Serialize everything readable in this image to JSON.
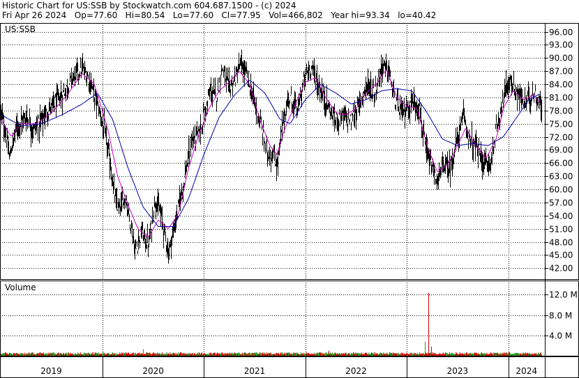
{
  "header": {
    "line1": "Historic Chart for US:SSB by Stockwatch.com 604.687.1500 - (c) 2024",
    "line2": "Fri Apr 26 2024   Op=77.60   Hi=80.54   Lo=77.60   Cl=77.95   Vol=466,802   Year hi=93.34   lo=40.42"
  },
  "colors": {
    "price_bars": "#000000",
    "ma_short": "#cc00cc",
    "ma_long": "#0000aa",
    "volume_up": "#2a9a2a",
    "volume_down": "#dd0000",
    "grid": "#000000"
  },
  "chart_data": [
    {
      "type": "line",
      "title": "US:SSB",
      "series_style": "ohlc bars with two moving averages",
      "y_ticks": [
        "96.00",
        "93.00",
        "90.00",
        "87.00",
        "84.00",
        "81.00",
        "78.00",
        "75.00",
        "72.00",
        "69.00",
        "66.00",
        "63.00",
        "60.00",
        "57.00",
        "54.00",
        "51.00",
        "48.00",
        "45.00",
        "42.00"
      ],
      "ylim": [
        39.5,
        98.0
      ],
      "x_labels": [
        "2019",
        "2020",
        "2021",
        "2022",
        "2023",
        "2024"
      ],
      "price_points": [
        {
          "t": 2019.0,
          "v": 77.5
        },
        {
          "t": 2019.05,
          "v": 72.0
        },
        {
          "t": 2019.08,
          "v": 67.0
        },
        {
          "t": 2019.15,
          "v": 74.5
        },
        {
          "t": 2019.25,
          "v": 76.5
        },
        {
          "t": 2019.32,
          "v": 73.5
        },
        {
          "t": 2019.4,
          "v": 76.0
        },
        {
          "t": 2019.5,
          "v": 79.0
        },
        {
          "t": 2019.6,
          "v": 81.5
        },
        {
          "t": 2019.7,
          "v": 85.5
        },
        {
          "t": 2019.8,
          "v": 87.5
        },
        {
          "t": 2019.87,
          "v": 85.0
        },
        {
          "t": 2019.94,
          "v": 80.0
        },
        {
          "t": 2020.0,
          "v": 75.0
        },
        {
          "t": 2020.06,
          "v": 68.0
        },
        {
          "t": 2020.12,
          "v": 58.0
        },
        {
          "t": 2020.16,
          "v": 55.0
        },
        {
          "t": 2020.22,
          "v": 58.5
        },
        {
          "t": 2020.28,
          "v": 52.0
        },
        {
          "t": 2020.32,
          "v": 45.5
        },
        {
          "t": 2020.38,
          "v": 50.5
        },
        {
          "t": 2020.45,
          "v": 47.0
        },
        {
          "t": 2020.52,
          "v": 58.0
        },
        {
          "t": 2020.58,
          "v": 53.5
        },
        {
          "t": 2020.65,
          "v": 45.5
        },
        {
          "t": 2020.72,
          "v": 53.0
        },
        {
          "t": 2020.8,
          "v": 62.0
        },
        {
          "t": 2020.88,
          "v": 71.0
        },
        {
          "t": 2020.95,
          "v": 73.0
        },
        {
          "t": 2021.0,
          "v": 77.0
        },
        {
          "t": 2021.06,
          "v": 82.5
        },
        {
          "t": 2021.12,
          "v": 81.0
        },
        {
          "t": 2021.18,
          "v": 88.0
        },
        {
          "t": 2021.24,
          "v": 83.0
        },
        {
          "t": 2021.3,
          "v": 85.0
        },
        {
          "t": 2021.36,
          "v": 88.5
        },
        {
          "t": 2021.42,
          "v": 86.0
        },
        {
          "t": 2021.48,
          "v": 81.0
        },
        {
          "t": 2021.55,
          "v": 75.5
        },
        {
          "t": 2021.62,
          "v": 68.5
        },
        {
          "t": 2021.68,
          "v": 67.5
        },
        {
          "t": 2021.72,
          "v": 65.5
        },
        {
          "t": 2021.78,
          "v": 76.0
        },
        {
          "t": 2021.84,
          "v": 81.0
        },
        {
          "t": 2021.92,
          "v": 78.0
        },
        {
          "t": 2022.0,
          "v": 86.5
        },
        {
          "t": 2022.06,
          "v": 88.0
        },
        {
          "t": 2022.12,
          "v": 84.0
        },
        {
          "t": 2022.2,
          "v": 80.0
        },
        {
          "t": 2022.28,
          "v": 76.0
        },
        {
          "t": 2022.36,
          "v": 77.0
        },
        {
          "t": 2022.44,
          "v": 75.5
        },
        {
          "t": 2022.52,
          "v": 79.0
        },
        {
          "t": 2022.6,
          "v": 84.0
        },
        {
          "t": 2022.68,
          "v": 82.0
        },
        {
          "t": 2022.76,
          "v": 88.5
        },
        {
          "t": 2022.82,
          "v": 87.0
        },
        {
          "t": 2022.88,
          "v": 80.0
        },
        {
          "t": 2022.95,
          "v": 77.5
        },
        {
          "t": 2023.0,
          "v": 78.5
        },
        {
          "t": 2023.06,
          "v": 80.0
        },
        {
          "t": 2023.12,
          "v": 79.0
        },
        {
          "t": 2023.18,
          "v": 69.0
        },
        {
          "t": 2023.24,
          "v": 65.0
        },
        {
          "t": 2023.3,
          "v": 61.5
        },
        {
          "t": 2023.36,
          "v": 66.0
        },
        {
          "t": 2023.42,
          "v": 64.5
        },
        {
          "t": 2023.5,
          "v": 72.0
        },
        {
          "t": 2023.56,
          "v": 76.5
        },
        {
          "t": 2023.62,
          "v": 71.0
        },
        {
          "t": 2023.7,
          "v": 69.0
        },
        {
          "t": 2023.76,
          "v": 66.0
        },
        {
          "t": 2023.82,
          "v": 65.5
        },
        {
          "t": 2023.88,
          "v": 74.0
        },
        {
          "t": 2023.94,
          "v": 80.0
        },
        {
          "t": 2024.0,
          "v": 85.0
        },
        {
          "t": 2024.08,
          "v": 82.0
        },
        {
          "t": 2024.16,
          "v": 79.5
        },
        {
          "t": 2024.24,
          "v": 82.5
        },
        {
          "t": 2024.3,
          "v": 80.0
        },
        {
          "t": 2024.33,
          "v": 78.0
        }
      ],
      "ma_short_points": [
        {
          "t": 2019.0,
          "v": 76.0
        },
        {
          "t": 2019.1,
          "v": 72.0
        },
        {
          "t": 2019.2,
          "v": 75.0
        },
        {
          "t": 2019.35,
          "v": 75.0
        },
        {
          "t": 2019.5,
          "v": 77.5
        },
        {
          "t": 2019.65,
          "v": 81.5
        },
        {
          "t": 2019.8,
          "v": 86.5
        },
        {
          "t": 2019.92,
          "v": 84.0
        },
        {
          "t": 2020.05,
          "v": 74.0
        },
        {
          "t": 2020.15,
          "v": 63.0
        },
        {
          "t": 2020.25,
          "v": 56.5
        },
        {
          "t": 2020.35,
          "v": 51.0
        },
        {
          "t": 2020.45,
          "v": 49.0
        },
        {
          "t": 2020.55,
          "v": 53.0
        },
        {
          "t": 2020.65,
          "v": 51.0
        },
        {
          "t": 2020.75,
          "v": 54.5
        },
        {
          "t": 2020.85,
          "v": 65.0
        },
        {
          "t": 2020.95,
          "v": 72.5
        },
        {
          "t": 2021.05,
          "v": 78.5
        },
        {
          "t": 2021.15,
          "v": 82.5
        },
        {
          "t": 2021.25,
          "v": 84.5
        },
        {
          "t": 2021.35,
          "v": 87.0
        },
        {
          "t": 2021.45,
          "v": 84.0
        },
        {
          "t": 2021.55,
          "v": 76.0
        },
        {
          "t": 2021.65,
          "v": 70.0
        },
        {
          "t": 2021.72,
          "v": 68.0
        },
        {
          "t": 2021.8,
          "v": 74.0
        },
        {
          "t": 2021.9,
          "v": 79.5
        },
        {
          "t": 2022.0,
          "v": 84.5
        },
        {
          "t": 2022.1,
          "v": 85.5
        },
        {
          "t": 2022.2,
          "v": 81.0
        },
        {
          "t": 2022.3,
          "v": 77.5
        },
        {
          "t": 2022.4,
          "v": 77.0
        },
        {
          "t": 2022.5,
          "v": 78.5
        },
        {
          "t": 2022.6,
          "v": 82.0
        },
        {
          "t": 2022.7,
          "v": 84.0
        },
        {
          "t": 2022.8,
          "v": 87.5
        },
        {
          "t": 2022.9,
          "v": 81.0
        },
        {
          "t": 2023.0,
          "v": 79.0
        },
        {
          "t": 2023.1,
          "v": 78.5
        },
        {
          "t": 2023.2,
          "v": 70.0
        },
        {
          "t": 2023.3,
          "v": 64.0
        },
        {
          "t": 2023.4,
          "v": 65.5
        },
        {
          "t": 2023.5,
          "v": 70.0
        },
        {
          "t": 2023.58,
          "v": 74.0
        },
        {
          "t": 2023.68,
          "v": 70.0
        },
        {
          "t": 2023.78,
          "v": 67.0
        },
        {
          "t": 2023.88,
          "v": 71.5
        },
        {
          "t": 2023.96,
          "v": 79.0
        },
        {
          "t": 2024.05,
          "v": 82.5
        },
        {
          "t": 2024.15,
          "v": 80.5
        },
        {
          "t": 2024.25,
          "v": 81.5
        },
        {
          "t": 2024.33,
          "v": 79.0
        }
      ],
      "ma_long_points": [
        {
          "t": 2019.0,
          "v": 77.0
        },
        {
          "t": 2019.2,
          "v": 74.5
        },
        {
          "t": 2019.4,
          "v": 75.0
        },
        {
          "t": 2019.6,
          "v": 77.0
        },
        {
          "t": 2019.8,
          "v": 79.5
        },
        {
          "t": 2019.95,
          "v": 82.0
        },
        {
          "t": 2020.1,
          "v": 76.0
        },
        {
          "t": 2020.25,
          "v": 65.0
        },
        {
          "t": 2020.4,
          "v": 56.0
        },
        {
          "t": 2020.55,
          "v": 51.5
        },
        {
          "t": 2020.7,
          "v": 51.5
        },
        {
          "t": 2020.85,
          "v": 58.0
        },
        {
          "t": 2021.0,
          "v": 68.0
        },
        {
          "t": 2021.15,
          "v": 76.5
        },
        {
          "t": 2021.3,
          "v": 81.5
        },
        {
          "t": 2021.45,
          "v": 85.0
        },
        {
          "t": 2021.6,
          "v": 82.0
        },
        {
          "t": 2021.75,
          "v": 76.0
        },
        {
          "t": 2021.85,
          "v": 75.0
        },
        {
          "t": 2022.0,
          "v": 80.5
        },
        {
          "t": 2022.15,
          "v": 84.0
        },
        {
          "t": 2022.3,
          "v": 82.0
        },
        {
          "t": 2022.45,
          "v": 79.5
        },
        {
          "t": 2022.6,
          "v": 80.5
        },
        {
          "t": 2022.75,
          "v": 82.5
        },
        {
          "t": 2022.9,
          "v": 83.0
        },
        {
          "t": 2023.05,
          "v": 82.5
        },
        {
          "t": 2023.2,
          "v": 77.5
        },
        {
          "t": 2023.35,
          "v": 71.5
        },
        {
          "t": 2023.5,
          "v": 70.0
        },
        {
          "t": 2023.65,
          "v": 70.5
        },
        {
          "t": 2023.8,
          "v": 70.0
        },
        {
          "t": 2023.95,
          "v": 72.0
        },
        {
          "t": 2024.1,
          "v": 77.0
        },
        {
          "t": 2024.2,
          "v": 80.5
        },
        {
          "t": 2024.33,
          "v": 82.0
        }
      ]
    },
    {
      "type": "bar",
      "title": "Volume",
      "y_ticks": [
        "12.0 M",
        "8.0 M",
        "4.0 M"
      ],
      "ylim": [
        0,
        14.8
      ],
      "unit": "M",
      "volume_spikes": [
        {
          "t": 2020.4,
          "v": 1.3,
          "dir": "up"
        },
        {
          "t": 2022.23,
          "v": 1.0,
          "dir": "down"
        },
        {
          "t": 2023.18,
          "v": 2.8,
          "dir": "up"
        },
        {
          "t": 2023.21,
          "v": 12.4,
          "dir": "down"
        },
        {
          "t": 2023.24,
          "v": 1.8,
          "dir": "down"
        }
      ],
      "baseline_volume_millions": 0.45
    }
  ]
}
